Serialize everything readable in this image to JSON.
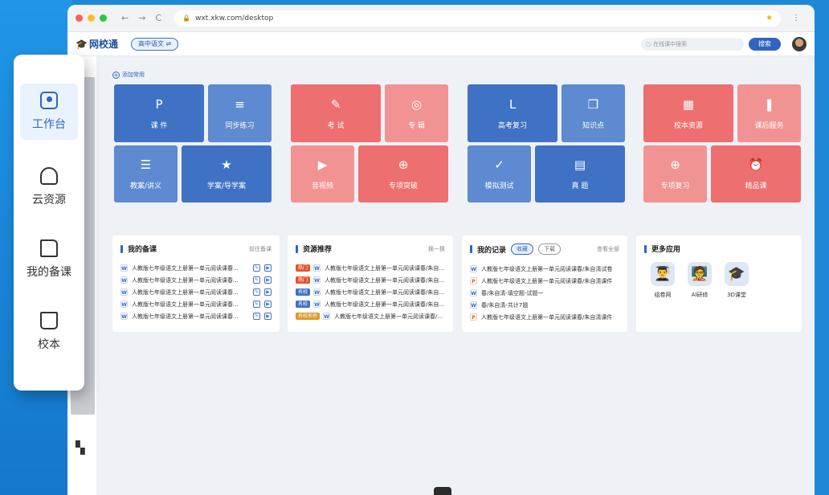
{
  "browser": {
    "url": "wxt.xkw.com/desktop",
    "back": "←",
    "forward": "→",
    "reload": "C",
    "lock": "🔒",
    "star": "★",
    "menu": "⋮"
  },
  "header": {
    "logo": "网校通",
    "subject": "高中语文 ⇌",
    "search_placeholder": "在线课中搜索",
    "search_button": "搜索"
  },
  "left_nav": [
    {
      "label": "工作台",
      "icon": "workbench-icon",
      "active": true
    },
    {
      "label": "云资源",
      "icon": "cloud-icon"
    },
    {
      "label": "我的备课",
      "icon": "lesson-prep-icon"
    },
    {
      "label": "校本",
      "icon": "school-folder-icon"
    }
  ],
  "add_common": "添加常用",
  "tiles": [
    {
      "label": "课 件",
      "icon": "P"
    },
    {
      "label": "同步练习",
      "icon": "≡"
    },
    {
      "label": "教案/讲义",
      "icon": "☰"
    },
    {
      "label": "学案/导学案",
      "icon": "★"
    },
    {
      "label": "考 试",
      "icon": "✎"
    },
    {
      "label": "专 辑",
      "icon": "◎"
    },
    {
      "label": "音视频",
      "icon": "▶"
    },
    {
      "label": "专项突破",
      "icon": "⊕"
    },
    {
      "label": "高考复习",
      "icon": "L"
    },
    {
      "label": "知识点",
      "icon": "❒"
    },
    {
      "label": "模拟测试",
      "icon": "✓"
    },
    {
      "label": "真 题",
      "icon": "▤"
    },
    {
      "label": "校本资源",
      "icon": "▦"
    },
    {
      "label": "课后服务",
      "icon": "❚"
    },
    {
      "label": "专项复习",
      "icon": "⊕"
    },
    {
      "label": "精品课",
      "icon": "⏰"
    }
  ],
  "cards": {
    "prep": {
      "title": "我的备课",
      "more": "前往备课",
      "rows": [
        {
          "text": "人教版七年级语文上册第一单元阅读课春..."
        },
        {
          "text": "人教版七年级语文上册第一单元阅读课春..."
        },
        {
          "text": "人教版七年级语文上册第一单元阅读课春..."
        },
        {
          "text": "人教版七年级语文上册第一单元阅读课春..."
        },
        {
          "text": "人教版七年级语文上册第一单元阅读课春..."
        }
      ]
    },
    "resources": {
      "title": "资源推荐",
      "more": "换一换",
      "rows": [
        {
          "tag": "热门",
          "text": "人教版七年级语文上册第一单元阅读课春/朱自清..."
        },
        {
          "tag": "热门",
          "text": "人教版七年级语文上册第一单元阅读课春/朱自清..."
        },
        {
          "tag": "名校",
          "text": "人教版七年级语文上册第一单元阅读课春/朱自清..."
        },
        {
          "tag": "名校",
          "text": "人教版七年级语文上册第一单元阅读课春/朱自清..."
        },
        {
          "tag": "名校名师",
          "text": "人教版七年级语文上册第一单元阅读课春/朱..."
        }
      ]
    },
    "records": {
      "title": "我的记录",
      "tab1": "收藏",
      "tab2": "下载",
      "more": "查看全部",
      "rows": [
        {
          "type": "W",
          "text": "人教版七年级语文上册第一单元阅读课春/朱自清试卷"
        },
        {
          "type": "P",
          "text": "人教版七年级语文上册第一单元阅读课春/朱自清课件"
        },
        {
          "type": "W",
          "text": "春/朱自清-填空题-试题一"
        },
        {
          "type": "W",
          "text": "春/朱自清-共计7题"
        },
        {
          "type": "P",
          "text": "人教版七年级语文上册第一单元阅读课春/朱自清课件"
        }
      ]
    },
    "apps": {
      "title": "更多应用",
      "items": [
        {
          "label": "组卷网",
          "icon": "👨‍🎓"
        },
        {
          "label": "AI研修",
          "icon": "🧑‍🏫"
        },
        {
          "label": "3D课堂",
          "icon": "🎓"
        }
      ]
    }
  },
  "file_glyph_w": "W",
  "file_glyph_p": "P",
  "qr_icon": "▚"
}
